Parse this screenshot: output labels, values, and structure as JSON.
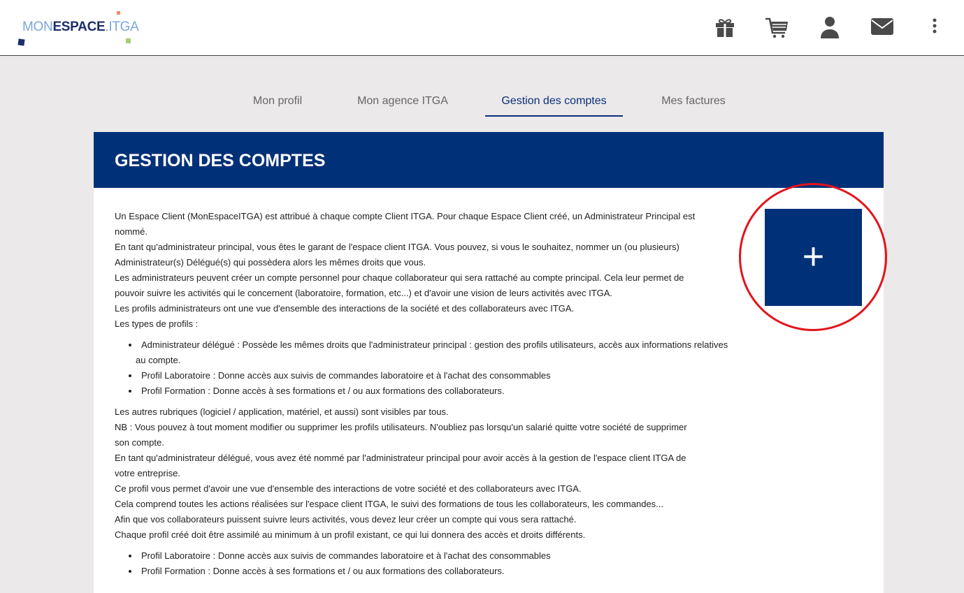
{
  "logo": {
    "part1": "MON",
    "part2": "ESPACE",
    "part3": ".ITGA"
  },
  "header_icons": [
    "gift-icon",
    "cart-icon",
    "user-icon",
    "mail-icon",
    "more-vertical-icon"
  ],
  "tabs": [
    {
      "label": "Mon profil"
    },
    {
      "label": "Mon agence ITGA"
    },
    {
      "label": "Gestion des comptes",
      "active": true
    },
    {
      "label": "Mes factures"
    }
  ],
  "page_title": "GESTION DES COMPTES",
  "colors": {
    "primary": "#003078",
    "highlight_circle": "#e3131b",
    "background": "#ebe9ea"
  },
  "add_button": {
    "label": "+"
  },
  "content": {
    "paragraphs1": [
      "Un Espace Client (MonEspaceITGA) est attribué à chaque compte Client ITGA. Pour chaque Espace Client créé, un Administrateur Principal est",
      "nommé.",
      "En tant qu'administrateur principal, vous êtes le garant de l'espace client ITGA. Vous pouvez, si vous le souhaitez, nommer un (ou plusieurs)",
      "Administrateur(s) Délégué(s) qui possèdera alors les mêmes droits que vous.",
      "Les administrateurs peuvent créer un compte personnel pour chaque collaborateur qui sera rattaché au compte principal. Cela leur permet de",
      "pouvoir suivre les activités qui le concernent (laboratoire, formation, etc...) et d'avoir une vision de leurs activités avec ITGA.",
      "Les profils administrateurs ont une vue d'ensemble des interactions de la société et des collaborateurs avec ITGA.",
      "Les types de profils :"
    ],
    "list1": [
      "Administrateur délégué : Possède les mêmes droits que l'administrateur principal : gestion des profils utilisateurs, accès aux informations relatives au compte.",
      "Profil Laboratoire : Donne accès aux suivis de commandes laboratoire et à l'achat des consommables",
      "Profil Formation : Donne accès à ses formations et / ou aux formations des collaborateurs."
    ],
    "paragraphs2": [
      "Les autres rubriques (logiciel / application, matériel, et aussi) sont visibles par tous.",
      "NB : Vous pouvez à tout moment modifier ou supprimer les profils utilisateurs. N'oubliez pas lorsqu'un salarié quitte votre société de supprimer",
      "son compte.",
      "En tant qu'administrateur délégué, vous avez été nommé par l'administrateur principal pour avoir accès à la gestion de l'espace client ITGA de",
      "votre entreprise.",
      "Ce profil vous permet d'avoir une vue d'ensemble des interactions de votre société et des collaborateurs avec ITGA.",
      "Cela comprend toutes les actions réalisées sur l'espace client ITGA, le suivi des formations de tous les collaborateurs, les commandes...",
      "Afin que vos collaborateurs puissent suivre leurs activités, vous devez leur créer un compte qui vous sera rattaché.",
      "Chaque profil créé doit être assimilé au minimum à un profil existant, ce qui lui donnera des accès et droits différents."
    ],
    "list2": [
      "Profil Laboratoire : Donne accès aux suivis de commandes laboratoire et à l'achat des consommables",
      "Profil Formation : Donne accès à ses formations et / ou aux formations des collaborateurs."
    ]
  }
}
